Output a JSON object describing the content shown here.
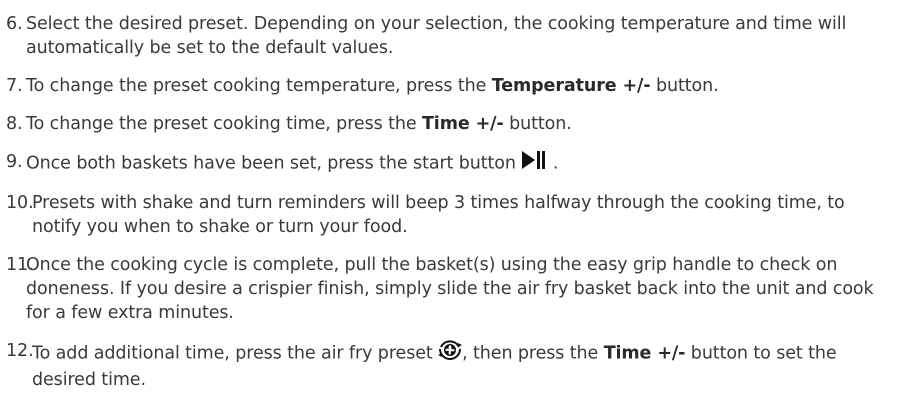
{
  "steps": [
    {
      "num": "6.",
      "text": "Select the desired preset. Depending on your selection, the cooking temperature and time will automatically be set to the default values."
    },
    {
      "num": "7.",
      "pre": "To change the preset cooking temperature, press the ",
      "bold": "Temperature +/-",
      "post": " button."
    },
    {
      "num": "8.",
      "pre": "To change the preset cooking time, press the ",
      "bold": "Time +/-",
      "post": " button."
    },
    {
      "num": "9.",
      "pre": "Once both baskets have been set, press the start button ",
      "icon": "play-pause-icon",
      "post": "."
    },
    {
      "num": "10.",
      "text": "Presets with shake and turn reminders will beep 3 times halfway through the cooking time, to notify you when to shake or turn your food."
    },
    {
      "num": "11.",
      "text": "Once the cooking cycle is complete, pull the basket(s) using the easy grip handle to check on doneness. If you desire a crispier finish, simply slide the air fry basket back into the unit and cook for a few extra minutes."
    },
    {
      "num": "12.",
      "pre": "To add additional time, press the air fry preset ",
      "icon": "air-fry-preset-icon",
      "mid": ", then press the ",
      "bold": "Time +/-",
      "post": " button to set the desired time."
    }
  ]
}
